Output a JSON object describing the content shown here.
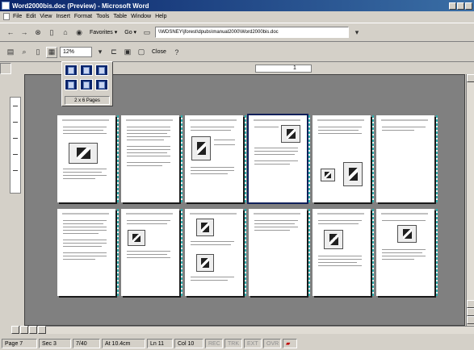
{
  "window": {
    "title": "Word2000bis.doc (Preview) - Microsoft Word"
  },
  "menu": [
    "File",
    "Edit",
    "View",
    "Insert",
    "Format",
    "Tools",
    "Table",
    "Window",
    "Help"
  ],
  "web_toolbar": {
    "favorites_label": "Favorites ▾",
    "go_label": "Go ▾",
    "address": "\\\\WDSNEY\\jforest\\dpubs\\manual2000\\Word2000bis.doc"
  },
  "preview_toolbar": {
    "zoom": "12%",
    "close_label": "Close"
  },
  "multipage_popup": {
    "label": "2 x 6 Pages"
  },
  "ruler": {
    "value": "1"
  },
  "status": {
    "page": "Page 7",
    "section": "Sec 3",
    "position": "7/40",
    "at": "At 10.4cm",
    "line": "Ln 11",
    "col": "Col 10",
    "ext_flags": [
      "REC",
      "TRK",
      "EXT",
      "OVR"
    ]
  }
}
